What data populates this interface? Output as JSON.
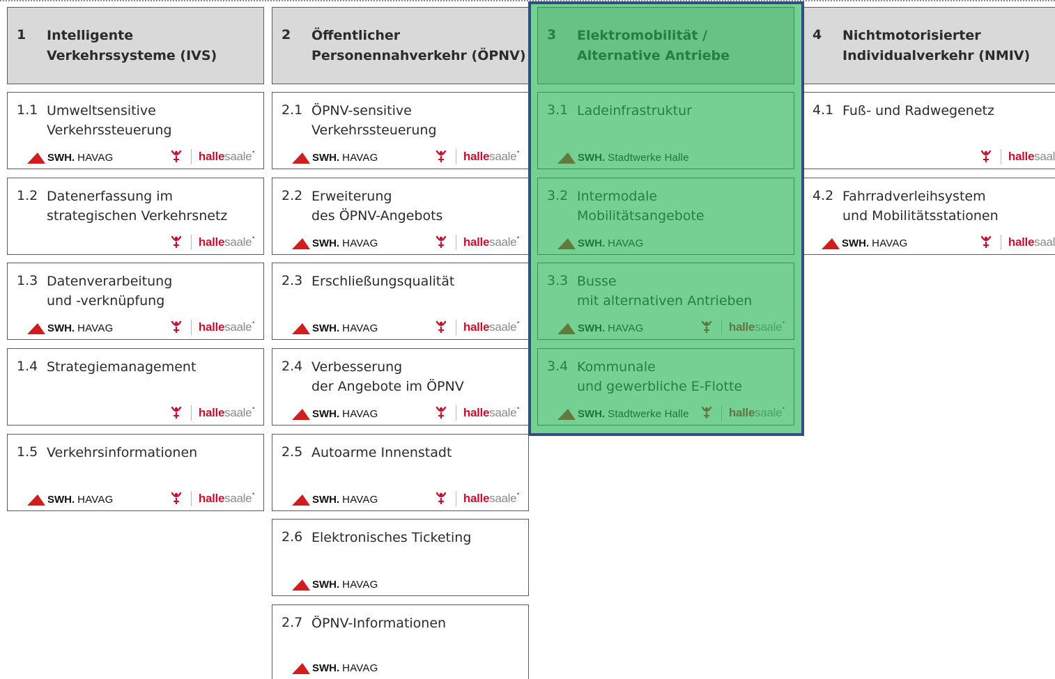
{
  "columns": [
    {
      "id": "col1",
      "header": {
        "number": "1",
        "title": "Intelligente\nVerkehrssysteme (IVS)"
      },
      "items": [
        {
          "number": "1.1",
          "title": "Umweltsensitive\nVerkehrssteuerung",
          "swh": "HAVAG",
          "halle": true
        },
        {
          "number": "1.2",
          "title": "Datenerfassung im\nstrategischen Verkehrsnetz",
          "swh": null,
          "halle": true
        },
        {
          "number": "1.3",
          "title": "Datenverarbeitung\nund -verknüpfung",
          "swh": "HAVAG",
          "halle": true
        },
        {
          "number": "1.4",
          "title": "Strategiemanagement",
          "swh": null,
          "halle": true
        },
        {
          "number": "1.5",
          "title": "Verkehrsinformationen",
          "swh": "HAVAG",
          "halle": true
        }
      ]
    },
    {
      "id": "col2",
      "header": {
        "number": "2",
        "title": "Öffentlicher\nPersonennahverkehr (ÖPNV)"
      },
      "items": [
        {
          "number": "2.1",
          "title": "ÖPNV-sensitive\nVerkehrssteuerung",
          "swh": "HAVAG",
          "halle": true
        },
        {
          "number": "2.2",
          "title": "Erweiterung\ndes ÖPNV-Angebots",
          "swh": "HAVAG",
          "halle": true
        },
        {
          "number": "2.3",
          "title": "Erschließungsqualität",
          "swh": "HAVAG",
          "halle": true
        },
        {
          "number": "2.4",
          "title": "Verbesserung\nder Angebote im ÖPNV",
          "swh": "HAVAG",
          "halle": true
        },
        {
          "number": "2.5",
          "title": "Autoarme Innenstadt",
          "swh": "HAVAG",
          "halle": true
        },
        {
          "number": "2.6",
          "title": "Elektronisches Ticketing",
          "swh": "HAVAG",
          "halle": false
        },
        {
          "number": "2.7",
          "title": "ÖPNV-Informationen",
          "swh": "HAVAG",
          "halle": false
        }
      ]
    },
    {
      "id": "col3",
      "highlighted": true,
      "header": {
        "number": "3",
        "title": "Elektromobilität /\nAlternative Antriebe"
      },
      "items": [
        {
          "number": "3.1",
          "title": "Ladeinfrastruktur",
          "swh": "Stadtwerke Halle",
          "halle": false
        },
        {
          "number": "3.2",
          "title": "Intermodale\nMobilitätsangebote",
          "swh": "HAVAG",
          "halle": false
        },
        {
          "number": "3.3",
          "title": "Busse\nmit alternativen Antrieben",
          "swh": "HAVAG",
          "halle": true
        },
        {
          "number": "3.4",
          "title": "Kommunale\nund gewerbliche E-Flotte",
          "swh": "Stadtwerke Halle",
          "halle": true
        }
      ]
    },
    {
      "id": "col4",
      "header": {
        "number": "4",
        "title": "Nichtmotorisierter\nIndividualverkehr (NMIV)"
      },
      "items": [
        {
          "number": "4.1",
          "title": "Fuß- und Radwegenetz",
          "swh": null,
          "halle": true
        },
        {
          "number": "4.2",
          "title": "Fahrradverleihsystem\nund Mobilitätsstationen",
          "swh": "HAVAG",
          "halle": true
        }
      ]
    }
  ],
  "logos": {
    "swh_brand": "SWH.",
    "halle_part1": "halle",
    "halle_part2": "saale",
    "halle_dot": "•",
    "swh_color": "#d01e1e",
    "halle_color": "#c8102e",
    "highlight_color": "#3cb371",
    "highlight_border": "#2f4f7f"
  }
}
